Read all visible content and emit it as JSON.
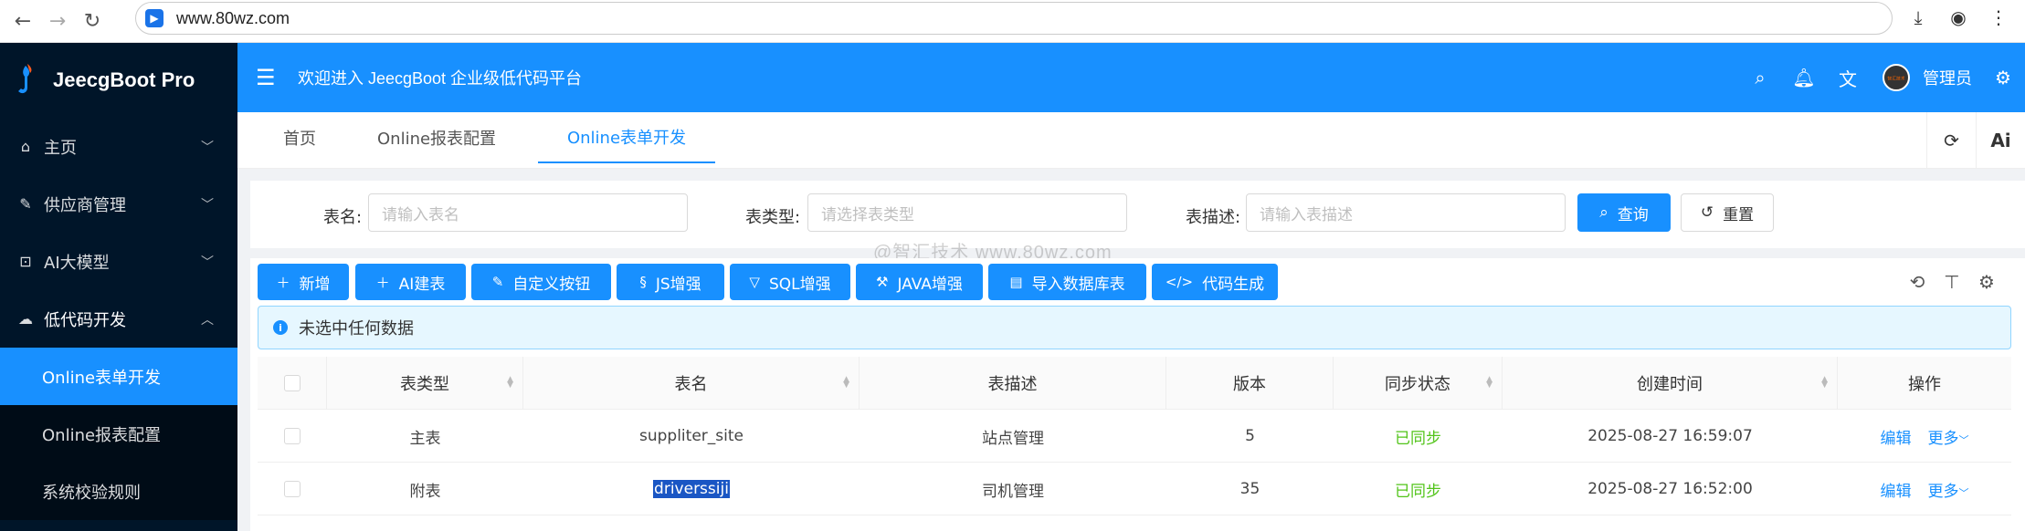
{
  "browser": {
    "url": "www.80wz.com"
  },
  "app": {
    "name": "JeecgBoot Pro",
    "welcome": "欢迎进入 JeecgBoot 企业级低代码平台",
    "username": "管理员",
    "avatar_text": "智汇技术"
  },
  "sidebar": {
    "items": [
      {
        "label": "主页",
        "icon": "home-icon"
      },
      {
        "label": "供应商管理",
        "icon": "edit-icon"
      },
      {
        "label": "AI大模型",
        "icon": "ai-model-icon"
      },
      {
        "label": "低代码开发",
        "icon": "cloud-icon"
      }
    ],
    "subitems": [
      {
        "label": "Online表单开发"
      },
      {
        "label": "Online报表配置"
      },
      {
        "label": "系统校验规则"
      }
    ]
  },
  "tabs": [
    {
      "label": "首页"
    },
    {
      "label": "Online报表配置"
    },
    {
      "label": "Online表单开发"
    }
  ],
  "tab_tools": {
    "ai_label": "Ai"
  },
  "search": {
    "table_name_label": "表名:",
    "table_name_placeholder": "请输入表名",
    "table_type_label": "表类型:",
    "table_type_placeholder": "请选择表类型",
    "table_desc_label": "表描述:",
    "table_desc_placeholder": "请输入表描述",
    "query_button": "查询",
    "reset_button": "重置"
  },
  "toolbar": {
    "buttons": [
      {
        "label": "新增"
      },
      {
        "label": "AI建表"
      },
      {
        "label": "自定义按钮"
      },
      {
        "label": "JS增强"
      },
      {
        "label": "SQL增强"
      },
      {
        "label": "JAVA增强"
      },
      {
        "label": "导入数据库表"
      },
      {
        "label": "代码生成"
      }
    ]
  },
  "alert": {
    "text": "未选中任何数据"
  },
  "watermark": "@智汇技术  www.80wz.com",
  "table": {
    "columns": [
      "表类型",
      "表名",
      "表描述",
      "版本",
      "同步状态",
      "创建时间",
      "操作"
    ],
    "rows": [
      {
        "type": "主表",
        "name": "suppliter_site",
        "desc": "站点管理",
        "version": "5",
        "sync": "已同步",
        "created": "2025-08-27 16:59:07",
        "edit": "编辑",
        "more": "更多"
      },
      {
        "type": "附表",
        "name": "driverssiji",
        "desc": "司机管理",
        "version": "35",
        "sync": "已同步",
        "created": "2025-08-27 16:52:00",
        "edit": "编辑",
        "more": "更多"
      }
    ]
  },
  "colors": {
    "primary": "#1890ff",
    "sidebar_bg": "#001529",
    "success": "#52c41a",
    "selection": "#1a56c4"
  }
}
